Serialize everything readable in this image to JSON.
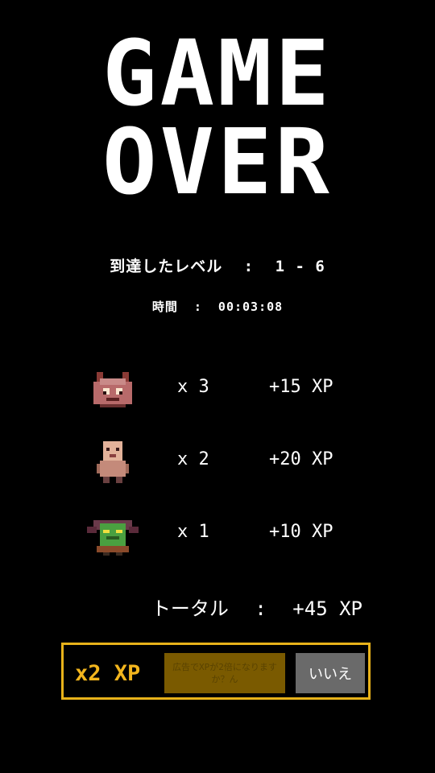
{
  "title": {
    "line1": "GAME",
    "line2": "OVER"
  },
  "level": {
    "label": "到達したレベル",
    "sep": ":",
    "value": "1 - 6"
  },
  "time": {
    "label": "時間",
    "sep": ":",
    "value": "00:03:08"
  },
  "kills": [
    {
      "enemy_icon": "horned-demon-icon",
      "count": "x 3",
      "xp": "+15 XP"
    },
    {
      "enemy_icon": "bald-ghoul-icon",
      "count": "x 2",
      "xp": "+20 XP"
    },
    {
      "enemy_icon": "green-goblin-icon",
      "count": "x 1",
      "xp": "+10 XP"
    }
  ],
  "total": {
    "label": "トータル",
    "sep": ":",
    "value": "+45 XP"
  },
  "bonus": {
    "multiplier": "x2 XP",
    "ad_button": "広告でXPが2倍になりますか？ん",
    "no_button": "いいえ"
  },
  "colors": {
    "background": "#000000",
    "accent": "#e8b21a",
    "text": "#ffffff"
  }
}
